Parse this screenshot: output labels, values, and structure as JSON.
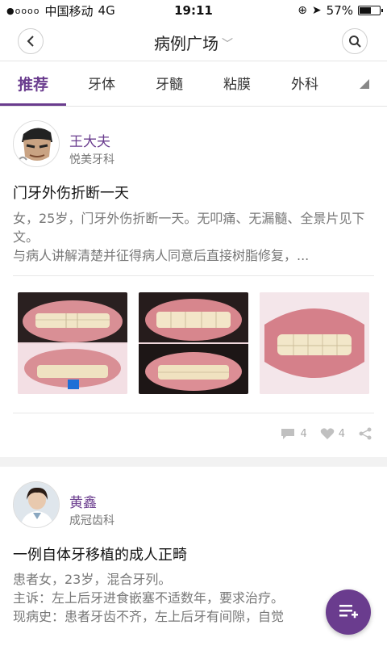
{
  "status_bar": {
    "signal": "●oooo",
    "carrier": "中国移动",
    "network": "4G",
    "time": "19:11",
    "battery": "57%",
    "battery_level": 0.57
  },
  "header": {
    "title": "病例广场",
    "back_icon": "chevron-left-icon",
    "search_icon": "search-icon"
  },
  "tabs": [
    {
      "label": "推荐",
      "active": true
    },
    {
      "label": "牙体",
      "active": false
    },
    {
      "label": "牙髓",
      "active": false
    },
    {
      "label": "粘膜",
      "active": false
    },
    {
      "label": "外科",
      "active": false
    }
  ],
  "posts": [
    {
      "author": "王大夫",
      "org": "悦美牙科",
      "title": "门牙外伤折断一天",
      "body": "女，25岁，门牙外伤折断一天。无叩痛、无漏髓、全景片见下文。\n与病人讲解清楚并征得病人同意后直接树脂修复，...",
      "comments": "4",
      "likes": "4"
    },
    {
      "author": "黄鑫",
      "org": "成冠齿科",
      "title": "一例自体牙移植的成人正畸",
      "body_lines": [
        "患者女，23岁，混合牙列。",
        "主诉：左上后牙进食嵌塞不适数年，要求治疗。",
        "现病史：患者牙齿不齐，左上后牙有间隙，自觉"
      ]
    }
  ],
  "colors": {
    "accent": "#6a3c8e",
    "muted": "#777777",
    "band": "#f2f2f2"
  }
}
